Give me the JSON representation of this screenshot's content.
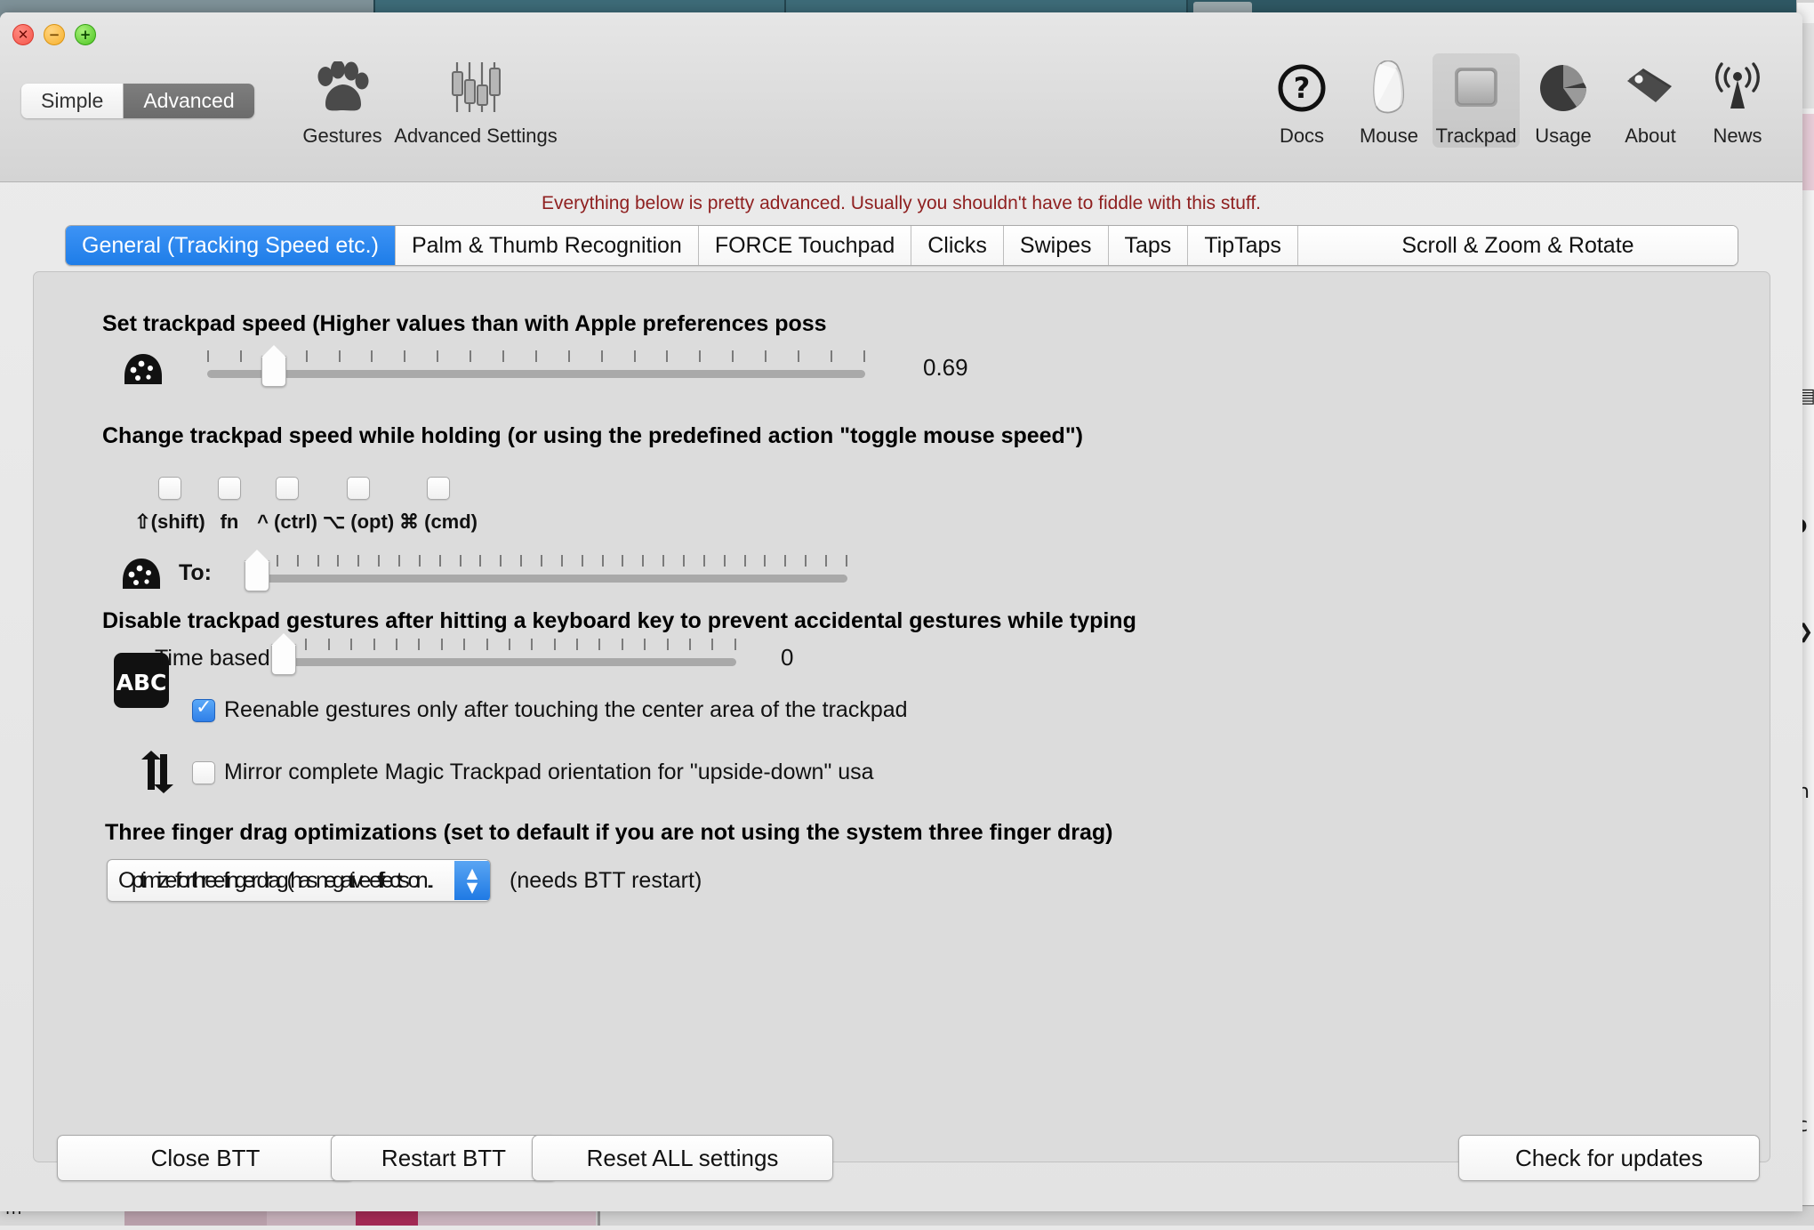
{
  "window": {
    "traffic_lights": [
      {
        "name": "close",
        "glyph": "✕"
      },
      {
        "name": "minimize",
        "glyph": "−"
      },
      {
        "name": "maximize",
        "glyph": "+"
      }
    ]
  },
  "toolbar": {
    "segmented": [
      {
        "label": "Simple",
        "active": false
      },
      {
        "label": "Advanced",
        "active": true
      }
    ],
    "left_items": [
      {
        "label": "Gestures",
        "icon": "paw-icon",
        "selected": false
      },
      {
        "label": "Advanced Settings",
        "icon": "sliders-icon",
        "selected": false
      }
    ],
    "right_items": [
      {
        "label": "Docs",
        "icon": "question-circle-icon",
        "selected": false
      },
      {
        "label": "Mouse",
        "icon": "mouse-icon",
        "selected": false
      },
      {
        "label": "Trackpad",
        "icon": "trackpad-icon",
        "selected": true
      },
      {
        "label": "Usage",
        "icon": "pie-chart-icon",
        "selected": false
      },
      {
        "label": "About",
        "icon": "tag-icon",
        "selected": false
      },
      {
        "label": "News",
        "icon": "broadcast-icon",
        "selected": false
      }
    ]
  },
  "content": {
    "warning": "Everything below is pretty advanced. Usually you shouldn't have to fiddle with this stuff.",
    "warning_color": "#8f2020",
    "accent_color": "#2b81ea",
    "tabs": [
      {
        "label": "General (Tracking Speed etc.)",
        "active": true
      },
      {
        "label": "Palm & Thumb Recognition",
        "active": false
      },
      {
        "label": "FORCE Touchpad",
        "active": false
      },
      {
        "label": "Clicks",
        "active": false
      },
      {
        "label": "Swipes",
        "active": false
      },
      {
        "label": "Taps",
        "active": false
      },
      {
        "label": "TipTaps",
        "active": false
      },
      {
        "label": "Scroll & Zoom & Rotate",
        "active": false
      }
    ],
    "sections": {
      "speed": {
        "heading": "Set trackpad speed (Higher values than with Apple preferences poss",
        "icon": "speedometer-icon",
        "value": "0.69",
        "thumb_percent": 10,
        "ticks": 21
      },
      "hold_speed": {
        "heading": "Change trackpad speed while holding (or using the predefined action \"toggle mouse speed\")",
        "modifiers": [
          {
            "label": "⇧(shift)",
            "checked": false
          },
          {
            "label": "fn",
            "checked": false
          },
          {
            "label": "^ (ctrl)",
            "checked": false
          },
          {
            "label": "⌥ (opt)",
            "checked": false
          },
          {
            "label": "⌘ (cmd)",
            "checked": false
          }
        ],
        "to_label": "To:",
        "icon": "speedometer-icon",
        "thumb_percent": 0,
        "ticks": 30
      },
      "disable_gestures": {
        "heading": "Disable trackpad gestures after hitting a keyboard key to prevent accidental gestures while typing",
        "icon": "abc-icon",
        "time_label": "Time based:",
        "time_value": "0",
        "thumb_percent": 0,
        "ticks": 21,
        "checkbox": {
          "label": "Reenable gestures only after touching the center area of the trackpad",
          "checked": true
        }
      },
      "mirror": {
        "icon": "flip-vertical-icon",
        "checkbox": {
          "label": "Mirror complete Magic Trackpad orientation for \"upside-down\" usa",
          "checked": false
        }
      },
      "three_finger": {
        "heading": "Three finger drag optimizations (set to default if you are not using the system three finger drag)",
        "select_value": "Optimize for three finger drag (has negative effects on ..",
        "note": "(needs BTT restart)"
      }
    }
  },
  "bottom_buttons": [
    {
      "label": "Close BTT",
      "name": "close-btt-button"
    },
    {
      "label": "Restart BTT",
      "name": "restart-btt-button"
    },
    {
      "label": "Reset ALL settings",
      "name": "reset-all-settings-button"
    },
    {
      "label": "Check for updates",
      "name": "check-for-updates-button"
    }
  ]
}
